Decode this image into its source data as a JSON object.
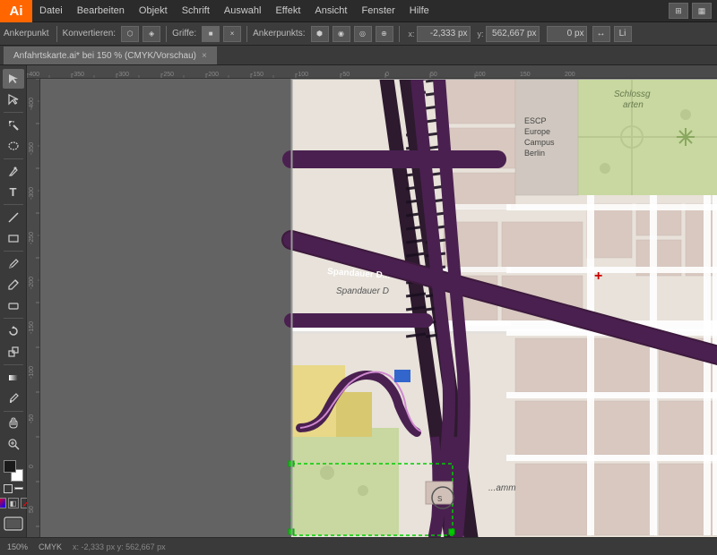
{
  "app": {
    "logo": "Ai",
    "title": "Adobe Illustrator"
  },
  "menubar": {
    "items": [
      "Datei",
      "Bearbeiten",
      "Objekt",
      "Schrift",
      "Auswahl",
      "Effekt",
      "Ansicht",
      "Fenster",
      "Hilfe"
    ]
  },
  "toolbar1": {
    "label1": "Ankerpunkt",
    "label2": "Konvertieren:",
    "label3": "Griffe:",
    "label4": "Ankerpunkts:",
    "x_label": "x:",
    "x_value": "-2,333 px",
    "y_label": "",
    "y_value": "562,667 px",
    "z_value": "0 px"
  },
  "tab": {
    "title": "Anfahrtskarte.ai* bei 150 % (CMYK/Vorschau)",
    "close": "×"
  },
  "tools": [
    {
      "name": "select",
      "icon": "↖"
    },
    {
      "name": "direct-select",
      "icon": "↗"
    },
    {
      "name": "magic-wand",
      "icon": "✦"
    },
    {
      "name": "lasso",
      "icon": "⌖"
    },
    {
      "name": "pen",
      "icon": "✒"
    },
    {
      "name": "pen-add",
      "icon": "+"
    },
    {
      "name": "type",
      "icon": "T"
    },
    {
      "name": "line",
      "icon": "/"
    },
    {
      "name": "rectangle",
      "icon": "▭"
    },
    {
      "name": "paintbrush",
      "icon": "🖌"
    },
    {
      "name": "pencil",
      "icon": "✏"
    },
    {
      "name": "eraser",
      "icon": "◻"
    },
    {
      "name": "rotate",
      "icon": "↻"
    },
    {
      "name": "scale",
      "icon": "⤡"
    },
    {
      "name": "warp",
      "icon": "⌀"
    },
    {
      "name": "gradient",
      "icon": "▦"
    },
    {
      "name": "eyedropper",
      "icon": "⚗"
    },
    {
      "name": "hand",
      "icon": "✋"
    },
    {
      "name": "zoom",
      "icon": "🔍"
    }
  ],
  "colors": {
    "foreground": "#1a1a1a",
    "background": "#ffffff"
  },
  "map": {
    "background_color": "#e8e0d8",
    "zoom": "150%",
    "mode": "CMYK/Vorschau"
  }
}
